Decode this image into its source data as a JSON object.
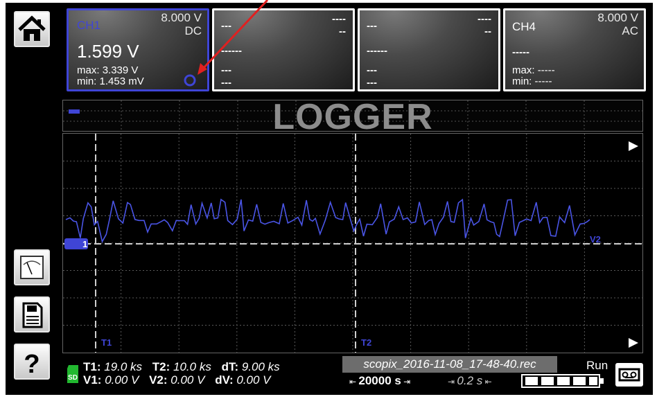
{
  "panels": [
    {
      "name": "CH1",
      "scale": "8.000 V",
      "coupling": "DC",
      "value": "1.599 V",
      "max_label": "max:",
      "max": "3.339 V",
      "min_label": "min:",
      "min": "1.453 mV"
    },
    {
      "name": "---",
      "scale": "----",
      "coupling": "--",
      "value": "------",
      "max_label": "",
      "max": "---",
      "min_label": "",
      "min": "---"
    },
    {
      "name": "---",
      "scale": "----",
      "coupling": "--",
      "value": "------",
      "max_label": "",
      "max": "---",
      "min_label": "",
      "min": "---"
    },
    {
      "name": "CH4",
      "scale": "8.000 V",
      "coupling": "AC",
      "value": "-----",
      "max_label": "max:",
      "max": "-----",
      "min_label": "min:",
      "min": "-----"
    }
  ],
  "mode_label": "LOGGER",
  "markers": {
    "ch_marker": "1",
    "t1": "T1",
    "t2": "T2",
    "v2": "V2"
  },
  "readout": {
    "t1_label": "T1:",
    "t1": "19.0 ks",
    "t2_label": "T2:",
    "t2": "10.0 ks",
    "dt_label": "dT:",
    "dt": "9.00 ks",
    "v1_label": "V1:",
    "v1": "0.00 V",
    "v2_label": "V2:",
    "v2": "0.00 V",
    "dv_label": "dV:",
    "dv": "0.00 V"
  },
  "file_name": "scopix_2016-11-08_17-48-40.rec",
  "duration": "20000 s",
  "interval": "0.2 s",
  "status": "Run",
  "colors": {
    "accent": "#3f45d6",
    "trace": "#4a55e6",
    "grid": "#5a5a5a"
  },
  "icons": [
    "home-icon",
    "meter-icon",
    "save-icon",
    "help-icon",
    "sd-card-icon",
    "cassette-icon",
    "battery-icon"
  ]
}
